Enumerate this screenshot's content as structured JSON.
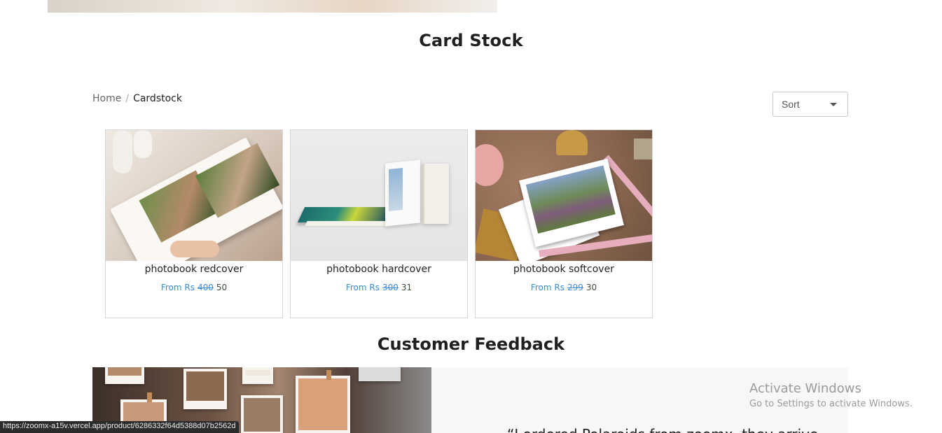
{
  "page": {
    "title": "Card Stock",
    "breadcrumb": {
      "home": "Home",
      "separator": "/",
      "current": "Cardstock"
    },
    "sort": {
      "label": "Sort"
    }
  },
  "products": [
    {
      "name": "photobook redcover",
      "price_prefix": "From Rs",
      "old_price": "400",
      "new_price": "50"
    },
    {
      "name": "photobook hardcover",
      "price_prefix": "From Rs",
      "old_price": "300",
      "new_price": "31"
    },
    {
      "name": "photobook softcover",
      "price_prefix": "From Rs",
      "old_price": "299",
      "new_price": "30"
    }
  ],
  "feedback": {
    "title": "Customer Feedback",
    "quote_start": "“I ordered Polaroids from zoomx, they arrive"
  },
  "windows_watermark": {
    "line1": "Activate Windows",
    "line2": "Go to Settings to activate Windows."
  },
  "status_bar": {
    "url": "https://zoomx-a15v.vercel.app/product/6286332f64d5388d07b2562d"
  },
  "colors": {
    "price_link": "#3b8bde",
    "price_new": "#3d4d3a",
    "card_border": "#d6d6d6",
    "feedback_panel": "#f7f7f7"
  }
}
